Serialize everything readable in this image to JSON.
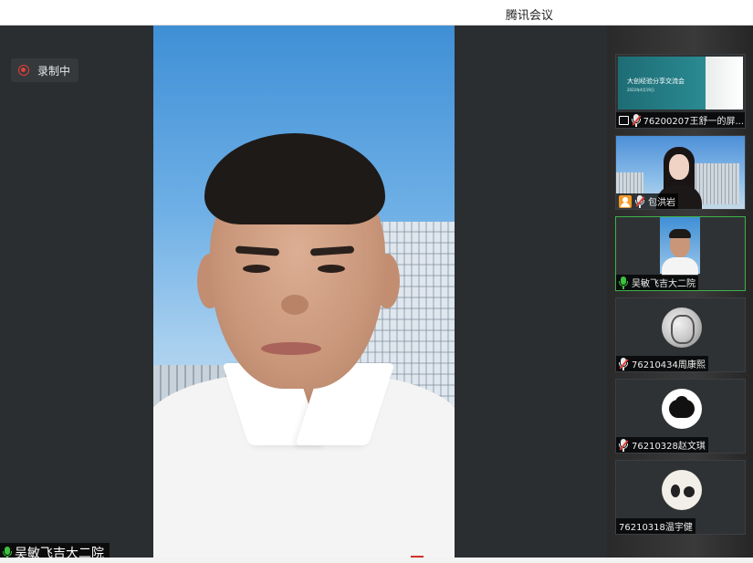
{
  "window": {
    "title": "腾讯会议"
  },
  "recording": {
    "label": "录制中"
  },
  "main_video": {
    "speaker_name": "吴敏飞吉大二院"
  },
  "participants": [
    {
      "name": "76200207王舒一的屏...",
      "type": "screen-share",
      "mic": "muted",
      "slide_title": "大创经验分享交流会",
      "slide_subtitle": "2022年4月19日"
    },
    {
      "name": "包洪岩",
      "type": "camera",
      "mic": "muted"
    },
    {
      "name": "吴敏飞吉大二院",
      "type": "camera",
      "mic": "active",
      "active": true
    },
    {
      "name": "76210434周康熙",
      "type": "avatar",
      "mic": "muted"
    },
    {
      "name": "76210328赵文琪",
      "type": "avatar",
      "mic": "muted"
    },
    {
      "name": "76210318温宇健",
      "type": "avatar",
      "mic": "none"
    }
  ],
  "colors": {
    "accent_green": "#3cb24a",
    "record_red": "#e0403a",
    "stage_bg": "#2b2e31"
  },
  "icons": [
    "record-icon",
    "microphone-icon",
    "microphone-muted-icon",
    "screen-share-icon",
    "person-icon"
  ]
}
